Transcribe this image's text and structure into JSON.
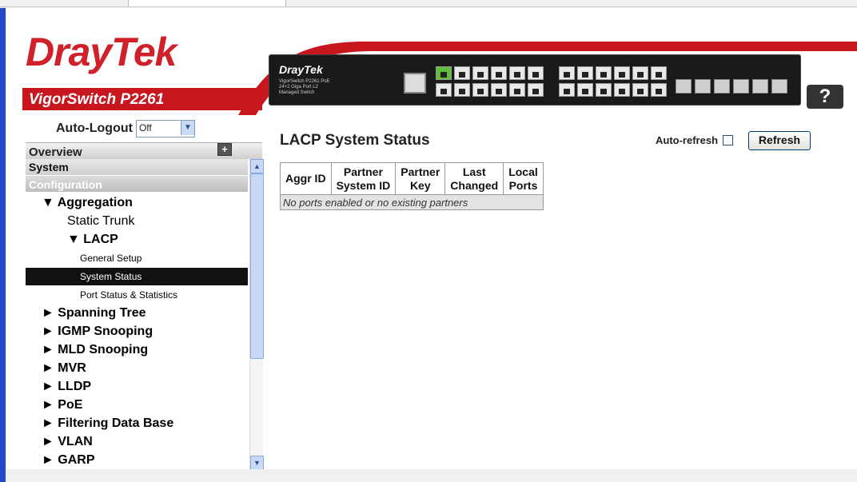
{
  "brand": {
    "logo": "DrayTek",
    "model": "VigorSwitch P2261",
    "device_logo": "DrayTek",
    "device_subtitle": "VigorSwitch P2261 PoE 24+2 Giga Port L2 Managed Switch"
  },
  "help_label": "?",
  "auto_logout": {
    "label": "Auto-Logout",
    "value": "Off"
  },
  "sidebar": {
    "overview": "Overview",
    "system": "System",
    "configuration": "Configuration",
    "items": [
      {
        "label": "▼ Aggregation",
        "level": 1,
        "bold": true
      },
      {
        "label": "Static Trunk",
        "level": 2,
        "bold": false
      },
      {
        "label": "▼ LACP",
        "level": 2,
        "bold": true
      },
      {
        "label": "General Setup",
        "level": 3,
        "bold": false
      },
      {
        "label": "System Status",
        "level": 3,
        "bold": false,
        "selected": true
      },
      {
        "label": "Port Status & Statistics",
        "level": 3,
        "bold": false
      },
      {
        "label": "► Spanning Tree",
        "level": 1,
        "bold": true
      },
      {
        "label": "► IGMP Snooping",
        "level": 1,
        "bold": true
      },
      {
        "label": "► MLD Snooping",
        "level": 1,
        "bold": true
      },
      {
        "label": "► MVR",
        "level": 1,
        "bold": true
      },
      {
        "label": "► LLDP",
        "level": 1,
        "bold": true
      },
      {
        "label": "► PoE",
        "level": 1,
        "bold": true
      },
      {
        "label": "► Filtering Data Base",
        "level": 1,
        "bold": true
      },
      {
        "label": "► VLAN",
        "level": 1,
        "bold": true
      },
      {
        "label": "► GARP",
        "level": 1,
        "bold": true
      }
    ]
  },
  "main": {
    "title": "LACP System Status",
    "auto_refresh_label": "Auto-refresh",
    "auto_refresh_checked": false,
    "refresh_button": "Refresh",
    "table": {
      "headers": [
        [
          "Aggr ID"
        ],
        [
          "Partner",
          "System ID"
        ],
        [
          "Partner",
          "Key"
        ],
        [
          "Last",
          "Changed"
        ],
        [
          "Local",
          "Ports"
        ]
      ],
      "empty_message": "No ports enabled or no existing partners"
    }
  },
  "colors": {
    "brand_red": "#d0202a",
    "selected_bg": "#111111",
    "window_frame": "#2348c8"
  }
}
